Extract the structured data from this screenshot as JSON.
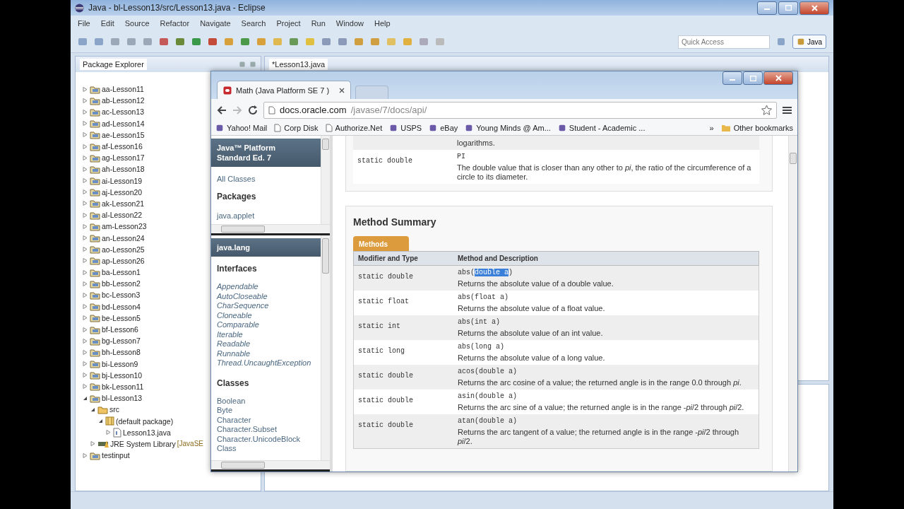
{
  "eclipse": {
    "title": "Java - bl-Lesson13/src/Lesson13.java - Eclipse",
    "menu": [
      "File",
      "Edit",
      "Source",
      "Refactor",
      "Navigate",
      "Search",
      "Project",
      "Run",
      "Window",
      "Help"
    ],
    "quick_access": {
      "placeholder": "Quick Access"
    },
    "perspective": {
      "label": "Java",
      "selected": true
    },
    "package_explorer": {
      "title": "Package Explorer",
      "tree": [
        {
          "label": "aa-Lesson11",
          "kind": "project",
          "expanded": false
        },
        {
          "label": "ab-Lesson12",
          "kind": "project",
          "expanded": false
        },
        {
          "label": "ac-Lesson13",
          "kind": "project",
          "expanded": false
        },
        {
          "label": "ad-Lesson14",
          "kind": "project",
          "expanded": false
        },
        {
          "label": "ae-Lesson15",
          "kind": "project",
          "expanded": false
        },
        {
          "label": "af-Lesson16",
          "kind": "project",
          "expanded": false
        },
        {
          "label": "ag-Lesson17",
          "kind": "project",
          "expanded": false
        },
        {
          "label": "ah-Lesson18",
          "kind": "project",
          "expanded": false
        },
        {
          "label": "ai-Lesson19",
          "kind": "project",
          "expanded": false
        },
        {
          "label": "aj-Lesson20",
          "kind": "project",
          "expanded": false
        },
        {
          "label": "ak-Lesson21",
          "kind": "project",
          "expanded": false
        },
        {
          "label": "al-Lesson22",
          "kind": "project",
          "expanded": false
        },
        {
          "label": "am-Lesson23",
          "kind": "project",
          "expanded": false
        },
        {
          "label": "an-Lesson24",
          "kind": "project",
          "expanded": false
        },
        {
          "label": "ao-Lesson25",
          "kind": "project",
          "expanded": false
        },
        {
          "label": "ap-Lesson26",
          "kind": "project",
          "expanded": false
        },
        {
          "label": "ba-Lesson1",
          "kind": "project",
          "expanded": false
        },
        {
          "label": "bb-Lesson2",
          "kind": "project",
          "expanded": false
        },
        {
          "label": "bc-Lesson3",
          "kind": "project",
          "expanded": false
        },
        {
          "label": "bd-Lesson4",
          "kind": "project",
          "expanded": false
        },
        {
          "label": "be-Lesson5",
          "kind": "project",
          "expanded": false
        },
        {
          "label": "bf-Lesson6",
          "kind": "project",
          "expanded": false
        },
        {
          "label": "bg-Lesson7",
          "kind": "project",
          "expanded": false
        },
        {
          "label": "bh-Lesson8",
          "kind": "project",
          "expanded": false
        },
        {
          "label": "bi-Lesson9",
          "kind": "project",
          "expanded": false
        },
        {
          "label": "bj-Lesson10",
          "kind": "project",
          "expanded": false
        },
        {
          "label": "bk-Lesson11",
          "kind": "project",
          "expanded": false
        },
        {
          "label": "bl-Lesson13",
          "kind": "project",
          "expanded": true,
          "children": [
            {
              "label": "src",
              "kind": "source",
              "expanded": true,
              "children": [
                {
                  "label": "(default package)",
                  "kind": "package",
                  "expanded": true,
                  "children": [
                    {
                      "label": "Lesson13.java",
                      "kind": "file",
                      "expanded": false
                    }
                  ]
                }
              ]
            },
            {
              "label": "JRE System Library",
              "note": "[JavaSE",
              "kind": "library",
              "expanded": false
            }
          ]
        },
        {
          "label": "testinput",
          "kind": "project",
          "expanded": false
        }
      ]
    },
    "editor_tab": {
      "label": "*Lesson13.java",
      "selected": true
    }
  },
  "browser": {
    "tabs": [
      {
        "label": "Math (Java Platform SE 7 )",
        "selected": true
      }
    ],
    "url": {
      "host": "docs.oracle.com",
      "path": "/javase/7/docs/api/"
    },
    "bookmarks": [
      {
        "label": "Yahoo! Mail",
        "kind": "site"
      },
      {
        "label": "Corp Disk",
        "kind": "page"
      },
      {
        "label": "Authorize.Net",
        "kind": "page"
      },
      {
        "label": "USPS",
        "kind": "site"
      },
      {
        "label": "eBay",
        "kind": "site"
      },
      {
        "label": "Young Minds @ Am...",
        "kind": "site"
      },
      {
        "label": "Student - Academic ...",
        "kind": "site"
      }
    ],
    "more_bookmarks": "»",
    "other_bookmarks": "Other bookmarks",
    "overview_frame": {
      "header": [
        "Java™ Platform",
        "Standard Ed. 7"
      ],
      "all_classes": "All Classes",
      "packages_title": "Packages",
      "packages": [
        "java.applet"
      ]
    },
    "package_frame": {
      "header": "java.lang",
      "interfaces_title": "Interfaces",
      "interfaces": [
        "Appendable",
        "AutoCloseable",
        "CharSequence",
        "Cloneable",
        "Comparable",
        "Iterable",
        "Readable",
        "Runnable",
        "Thread.UncaughtException"
      ],
      "classes_title": "Classes",
      "classes": [
        "Boolean",
        "Byte",
        "Character",
        "Character.Subset",
        "Character.UnicodeBlock",
        "Class"
      ]
    },
    "doc": {
      "fields": [
        {
          "description": "logarithms."
        },
        {
          "modifier": "static double",
          "name": "PI",
          "description": "The double value that is closer than any other to *pi*, the ratio of the circumference of a circle to its diameter."
        }
      ],
      "method_summary": {
        "title": "Method Summary",
        "tab": {
          "label": "Methods",
          "selected": true
        },
        "columns": [
          "Modifier and Type",
          "Method and Description"
        ],
        "rows": [
          {
            "modifier": "static double",
            "method": [
              {
                "text": "abs(",
                "selected": false
              },
              {
                "text": "double a",
                "selected": true
              },
              {
                "text": ")",
                "selected": false
              }
            ],
            "description": "Returns the absolute value of a double value."
          },
          {
            "modifier": "static float",
            "method": [
              {
                "text": "abs(float a)",
                "selected": false
              }
            ],
            "description": "Returns the absolute value of a float value."
          },
          {
            "modifier": "static int",
            "method": [
              {
                "text": "abs(int a)",
                "selected": false
              }
            ],
            "description": "Returns the absolute value of an int value."
          },
          {
            "modifier": "static long",
            "method": [
              {
                "text": "abs(long a)",
                "selected": false
              }
            ],
            "description": "Returns the absolute value of a long value."
          },
          {
            "modifier": "static double",
            "method": [
              {
                "text": "acos(double a)",
                "selected": false
              }
            ],
            "description": "Returns the arc cosine of a value; the returned angle is in the range 0.0 through *pi*."
          },
          {
            "modifier": "static double",
            "method": [
              {
                "text": "asin(double a)",
                "selected": false
              }
            ],
            "description": "Returns the arc sine of a value; the returned angle is in the range -*pi*/2 through *pi*/2."
          },
          {
            "modifier": "static double",
            "method": [
              {
                "text": "atan(double a)",
                "selected": false
              }
            ],
            "description": "Returns the arc tangent of a value; the returned angle is in the range -*pi*/2 through *pi*/2."
          }
        ]
      }
    }
  }
}
